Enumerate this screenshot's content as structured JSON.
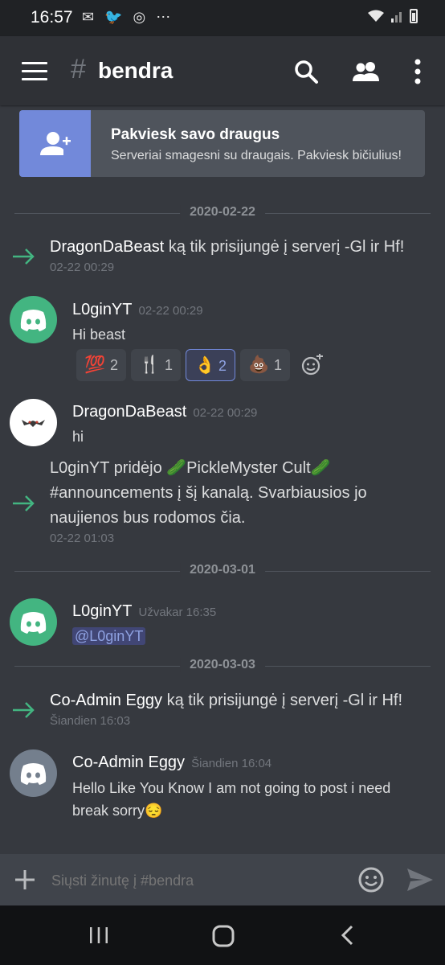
{
  "status_bar": {
    "time": "16:57",
    "notification_icons": "✉ 🐦 ◎ ⋯",
    "right_icons": "wifi signal battery"
  },
  "header": {
    "hash": "#",
    "channel": "bendra",
    "icons": [
      "menu-icon",
      "search-icon",
      "members-icon",
      "more-icon"
    ]
  },
  "invite_banner": {
    "title": "Pakviesk savo draugus",
    "subtitle": "Serveriai smagesni su draugais. Pakviesk bičiulius!"
  },
  "dividers": [
    "2020-02-22",
    "2020-03-01",
    "2020-03-03"
  ],
  "messages": [
    {
      "type": "system",
      "name": "DragonDaBeast",
      "text": " ką tik prisijungė į serverį -Gl ir Hf!",
      "time": "02-22 00:29"
    },
    {
      "type": "user",
      "author": "L0ginYT",
      "time": "02-22 00:29",
      "text": "Hi beast",
      "reactions": [
        {
          "emoji": "💯",
          "count": "2"
        },
        {
          "emoji": "🍴",
          "count": "1"
        },
        {
          "emoji": "👌",
          "count": "2"
        },
        {
          "emoji": "💩",
          "count": "1"
        }
      ]
    },
    {
      "type": "user",
      "author": "DragonDaBeast",
      "time": "02-22 00:29",
      "text": "hi"
    },
    {
      "type": "system",
      "line1": "L0ginYT pridėjo 🥒PickleMyster Cult🥒",
      "line2": "#announcements į šį kanalą. Svarbiausios jo",
      "line3": "naujienos bus rodomos čia.",
      "time": "02-22 01:03"
    },
    {
      "type": "user",
      "author": "L0ginYT",
      "time": "Užvakar 16:35",
      "text": "@L0ginYT"
    },
    {
      "type": "system",
      "name": "Co-Admin Eggy",
      "text": " ką tik prisijungė į serverį -Gl ir Hf!",
      "time": "Šiandien 16:03"
    },
    {
      "type": "user",
      "author": "Co-Admin Eggy",
      "time": "Šiandien 16:04",
      "line1": "Hello Like You Know I am not going to post i need",
      "line2": "break sorry😔"
    }
  ],
  "composer": {
    "placeholder": "Siųsti žinutę į #bendra"
  },
  "colors": {
    "background": "#36393f",
    "header": "#2f3136",
    "blurple": "#7289da",
    "green": "#43b581",
    "system_arrow": "#43b581"
  }
}
